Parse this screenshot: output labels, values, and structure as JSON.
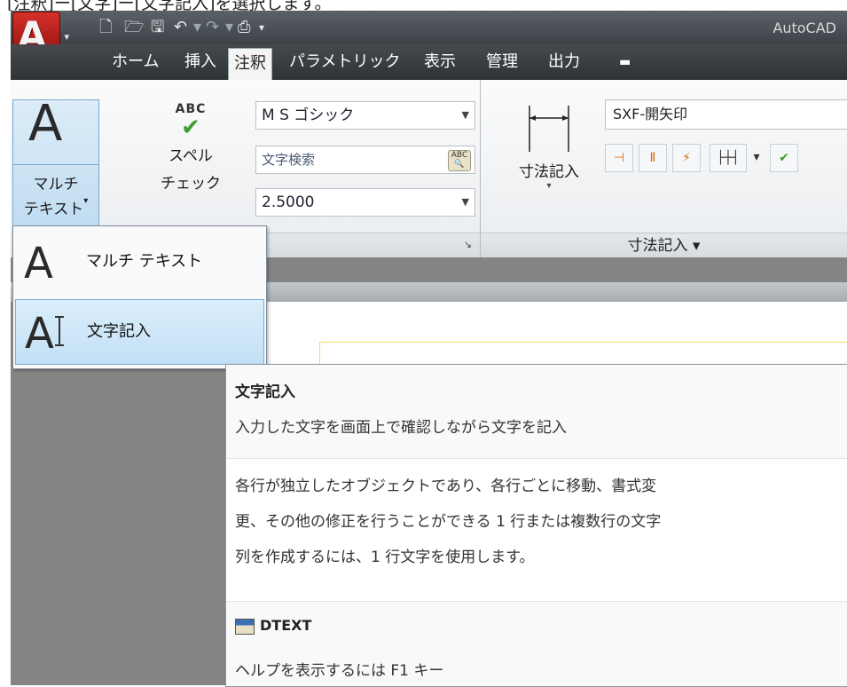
{
  "instruction": "[注釈]ー[文字]ー[文字記入]を選択します。",
  "app": {
    "title": "AutoCAD",
    "logo_letter": "A"
  },
  "tabs": [
    "ホーム",
    "挿入",
    "注釈",
    "パラメトリック",
    "表示",
    "管理",
    "出力"
  ],
  "active_tab": "注釈",
  "text_panel": {
    "multitext_l1": "マルチ",
    "multitext_l2": "テキスト",
    "spell_abc": "ABC",
    "spell_l1": "スペル",
    "spell_l2": "チェック",
    "font_value": "M S ゴシック",
    "find_placeholder": "文字検索",
    "height_value": "2.5000"
  },
  "dim_panel": {
    "label": "寸法記入",
    "style_value": "SXF-開矢印",
    "footer": "寸法記入 ▾"
  },
  "menu": {
    "items": [
      "マルチ テキスト",
      "文字記入"
    ]
  },
  "tooltip": {
    "title": "文字記入",
    "subtitle": "入力した文字を画面上で確認しながら文字を記入",
    "body": [
      "各行が独立したオブジェクトであり、各行ごとに移動、書式変",
      "更、その他の修正を行うことができる 1 行または複数行の文字",
      "列を作成するには、1 行文字を使用します。"
    ],
    "command": "DTEXT",
    "help": "ヘルプを表示するには F1 キー"
  }
}
